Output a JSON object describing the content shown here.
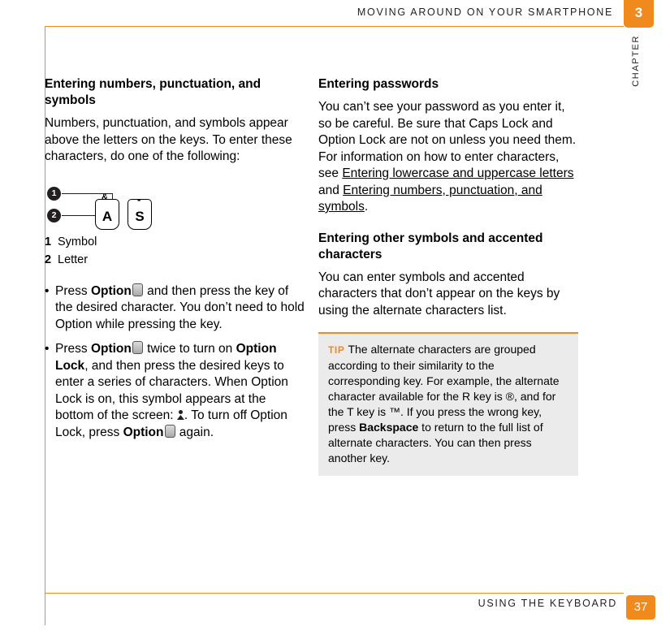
{
  "header": {
    "title": "MOVING AROUND ON YOUR SMARTPHONE",
    "chapter_number": "3",
    "chapter_word": "CHAPTER"
  },
  "footer": {
    "title": "USING THE KEYBOARD",
    "page_number": "37"
  },
  "left_column": {
    "heading": "Entering numbers, punctuation, and symbols",
    "intro": "Numbers, punctuation, and symbols appear above the letters on the keys. To enter these characters, do one of the following:",
    "diagram": {
      "callout_1": "1",
      "callout_2": "2",
      "key_a_alt": "&",
      "key_a_main": "A",
      "key_s_alt": "-",
      "key_s_main": "S"
    },
    "legend": [
      {
        "num": "1",
        "label": "Symbol"
      },
      {
        "num": "2",
        "label": "Letter"
      }
    ],
    "bullets": [
      {
        "pre": "Press ",
        "bold1": "Option",
        "mid": " and then press the key of the desired character. You don’t need to hold Option while pressing the key."
      },
      {
        "pre": "Press ",
        "bold1": "Option",
        "mid": " twice to turn on ",
        "bold2": "Option Lock",
        "mid2": ", and then press the desired keys to enter a series of characters. When Option Lock is on, this symbol appears at the bottom of the screen: ",
        "mid3": ". To turn off Option Lock, press ",
        "bold3": "Option",
        "tail": " again."
      }
    ]
  },
  "right_column": {
    "heading1": "Entering passwords",
    "para1_a": "You can’t see your password as you enter it, so be careful. Be sure that Caps Lock and Option Lock are not on unless you need them. For information on how to enter characters, see ",
    "link1": "Entering lowercase and uppercase letters",
    "para1_b": " and ",
    "link2": "Entering numbers, punctuation, and symbols",
    "para1_c": ".",
    "heading2": "Entering other symbols and accented characters",
    "para2": "You can enter symbols and accented characters that don’t appear on the keys by using the alternate characters list.",
    "tip": {
      "label": "TIP",
      "text_a": "The alternate characters are grouped according to their similarity to the corresponding key. For example, the alternate character available for the R key is ®, and for the T key is ™. If you press the wrong key, press ",
      "bold": "Backspace",
      "text_b": " to return to the full list of alternate characters. You can then press another key."
    }
  },
  "colors": {
    "accent": "#f08a1c",
    "tip_background": "#ebebeb",
    "text": "#000000"
  }
}
